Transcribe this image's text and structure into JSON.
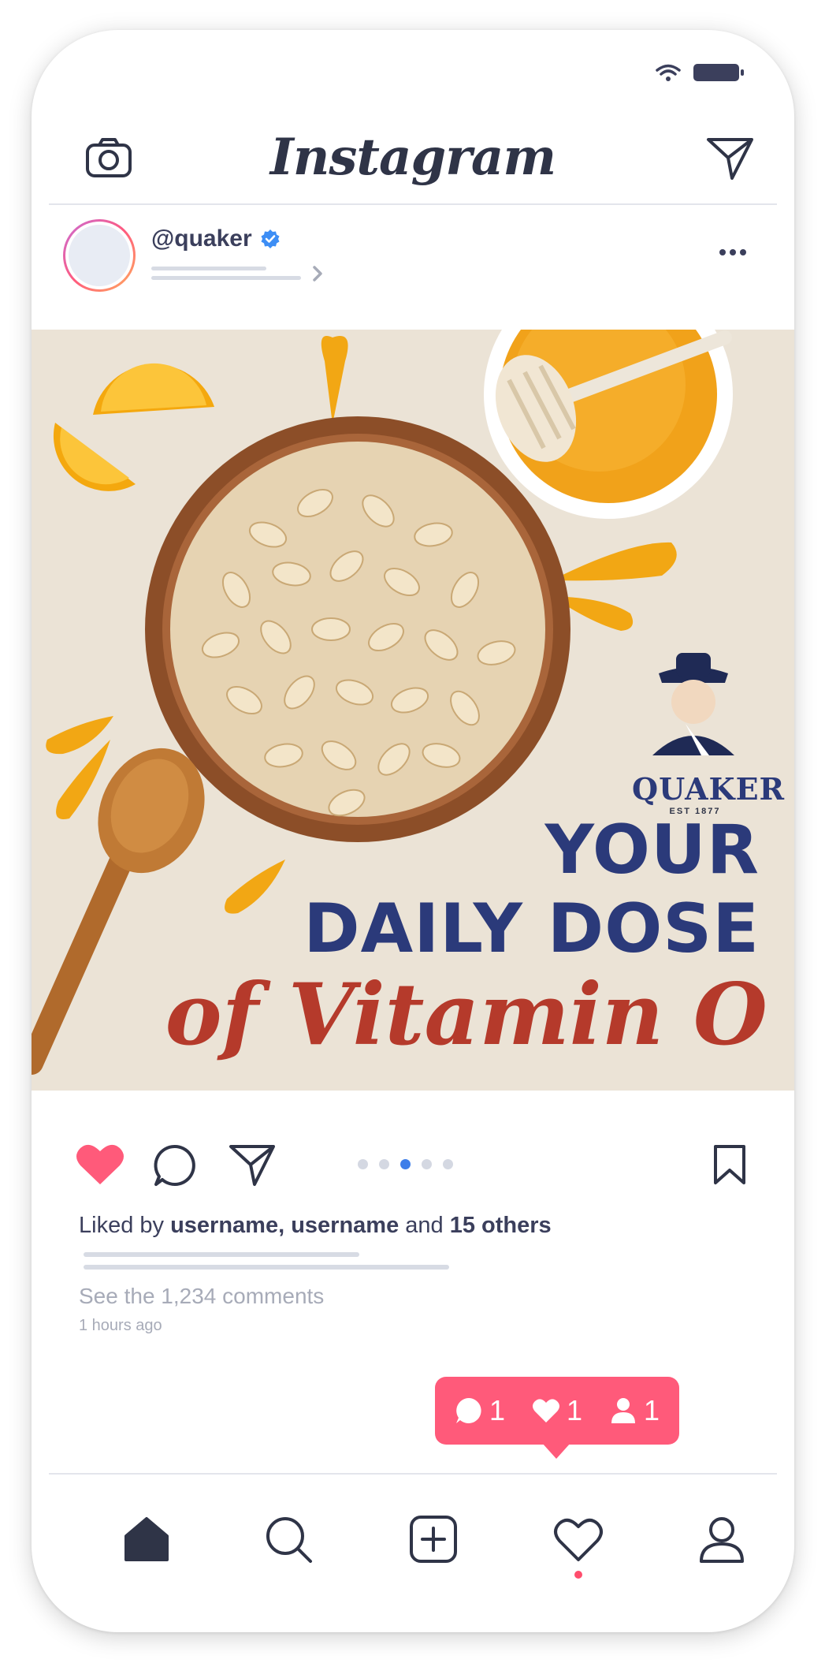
{
  "app": {
    "brand": "Instagram"
  },
  "post": {
    "username": "@quaker",
    "verified": true,
    "image": {
      "headline_line1": "YOUR",
      "headline_line2": "DAILY DOSE",
      "headline_line3": "of Vitamin O",
      "logo_name": "QUAKER",
      "logo_est": "EST 1877"
    },
    "carousel": {
      "count": 5,
      "active_index": 2
    },
    "liked_prefix": "Liked by ",
    "liked_users": "username, username",
    "liked_and": " and ",
    "liked_others": "15 others",
    "comments_link": "See the 1,234 comments",
    "timestamp": "1 hours ago"
  },
  "notification": {
    "comments": "1",
    "likes": "1",
    "followers": "1"
  },
  "colors": {
    "text": "#2f3447",
    "like_red": "#ff5a7a",
    "carousel_active": "#3d7ee9",
    "headline_blue": "#2b3a7a",
    "headline_red": "#b53a2b",
    "image_bg": "#ebe3d6"
  },
  "icons": {
    "header": [
      "camera-icon",
      "direct-message-icon"
    ],
    "post": [
      "verified-badge-icon",
      "more-options-icon"
    ],
    "actions": [
      "heart-icon",
      "comment-icon",
      "share-icon",
      "bookmark-icon"
    ],
    "nav": [
      "home-icon",
      "search-icon",
      "add-post-icon",
      "activity-heart-icon",
      "profile-icon"
    ]
  }
}
